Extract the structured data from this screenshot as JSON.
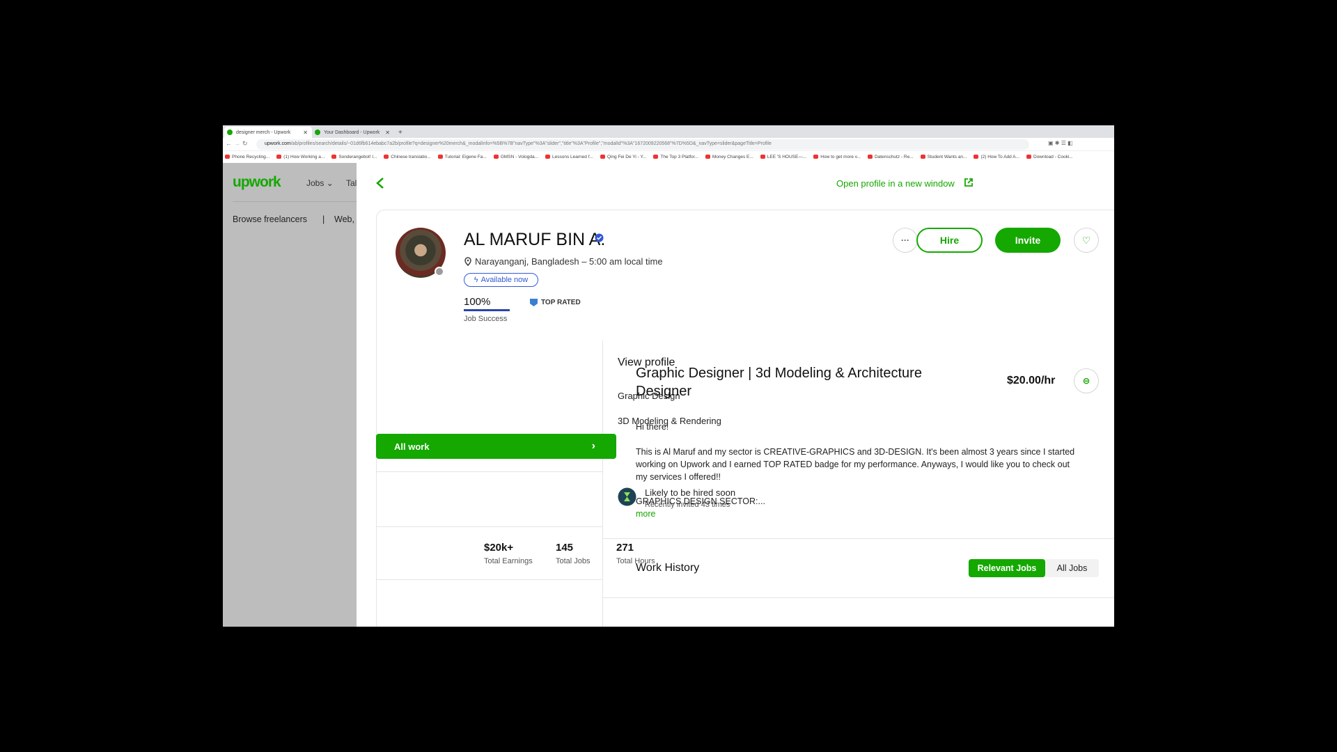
{
  "browser": {
    "tabs": [
      {
        "title": "designer merch - Upwork",
        "active": true
      },
      {
        "title": "Your Dashboard - Upwork",
        "active": false
      }
    ],
    "url_domain": "upwork.com",
    "url_path": "/ab/profiles/search/details/~01d6fb614ebabc7a2b/profile?q=designer%20merch&_modalInfo=%5B%7B\"navType\"%3A\"slider\",\"title\"%3A\"Profile\",\"modalId\"%3A\"1672009220568\"%7D%5D&_navType=slider&pageTitle=Profile",
    "bookmarks": [
      "Phone Recycling...",
      "(1) How Working a...",
      "Sonderangebot! l...",
      "Chinese translatio...",
      "Tutorial: Eigene Fa...",
      "GMSN - Vologda...",
      "Lessons Learned f...",
      "Qing Fei De Yi - Y...",
      "The Top 3 Platfor...",
      "Money Changes E...",
      "LEE 'S HOUSE—...",
      "How to get more v...",
      "Datenschutz - Re...",
      "Student Wants an...",
      "(2) How To Add A...",
      "Download - Cooki..."
    ]
  },
  "background": {
    "logo": "upwork",
    "nav_jobs": "Jobs",
    "nav_talent": "Tal",
    "browse": "Browse freelancers",
    "sep": "|",
    "crumb": "Web,"
  },
  "modal": {
    "open_profile": "Open profile in a new window"
  },
  "profile": {
    "name": "AL MARUF BIN A.",
    "location": "Narayanganj, Bangladesh – 5:00 am local time",
    "available": "Available now",
    "job_success_value": "100%",
    "job_success_label": "Job Success",
    "job_success_percent": 100,
    "badge": "TOP RATED",
    "hire": "Hire",
    "invite": "Invite",
    "online_status": "offline",
    "accent": "#14a800",
    "verified_color": "#3258d4"
  },
  "sidebar": {
    "view_profile": "View profile",
    "items": [
      {
        "label": "Graphic Design"
      },
      {
        "label": "3D Modeling & Rendering"
      },
      {
        "label": "All work",
        "selected": true
      }
    ],
    "hire_title": "Likely to be hired soon",
    "hire_sub": "Recently invited 43 times",
    "stats": [
      {
        "value": "$20k+",
        "label": "Total Earnings"
      },
      {
        "value": "145",
        "label": "Total Jobs"
      },
      {
        "value": "271",
        "label": "Total Hours"
      }
    ]
  },
  "main": {
    "title_line1": "Graphic Designer | 3d Modeling & Architecture",
    "title_line2": "Designer",
    "rate": "$20.00/hr",
    "greeting": "Hi there!",
    "para1": "This is Al Maruf and my sector is CREATIVE-GRAPHICS and 3D-DESIGN. It's been almost 3 years since I started",
    "para2": "working on Upwork and I earned TOP RATED badge for my performance. Anyways, I would like you to check out",
    "para3": "my services I offered!!",
    "sector": "GRAPHICS DESIGN SECTOR:...",
    "more": "more",
    "work_history": "Work History",
    "relevant_jobs": "Relevant Jobs",
    "all_jobs": "All Jobs"
  }
}
